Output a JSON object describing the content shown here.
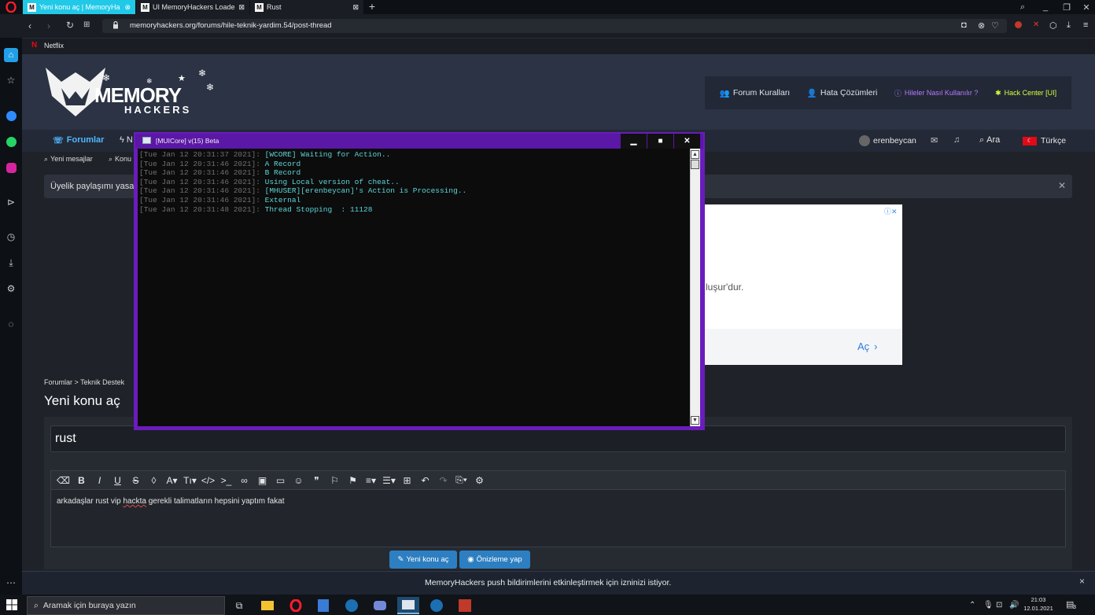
{
  "browser": {
    "tabs": [
      {
        "label": "Yeni konu aç | MemoryHa",
        "favicon": "M"
      },
      {
        "label": "UI MemoryHackers Loader",
        "favicon": "M"
      },
      {
        "label": "Rust",
        "favicon": "M"
      }
    ],
    "url": "memoryhackers.org/forums/hile-teknik-yardim.54/post-thread",
    "bookmark": "Netflix"
  },
  "site": {
    "logo_top": "MEMORY",
    "logo_bottom": "HACKERS",
    "topnav": [
      "Forum Kuralları",
      "Hata Çözümleri",
      "Hileler Nasıl Kullanılır ?",
      "Hack Center [UI]"
    ],
    "nav": {
      "forums": "Forumlar",
      "partial": "N",
      "user": "erenbeycan",
      "search": "Ara",
      "language": "Türkçe"
    },
    "subnav": {
      "new_messages": "Yeni mesajlar",
      "partial": "Konu"
    },
    "notice": "Üyelik paylaşımı yasa",
    "ad_text": "luşur'dur.",
    "ad_button": "Aç",
    "breadcrumb": {
      "root": "Forumlar",
      "sep": ">",
      "child": "Teknik Destek"
    },
    "page_title": "Yeni konu aç",
    "thread_title": "rust",
    "editor_text_1": "arkadaşlar rust vip ",
    "editor_text_err": "hackta",
    "editor_text_2": " gerekli talimatların hepsini yaptım fakat",
    "btn_post": "Yeni konu aç",
    "btn_preview": "Önizleme yap",
    "push_text": "MemoryHackers push bildirimlerini etkinleştirmek için izninizi istiyor.",
    "push_close": "×"
  },
  "console": {
    "title": "[MUICore] v(15) Beta",
    "lines": [
      {
        "ts": "[Tue Jan 12 20:31:37 2021]: ",
        "msg": "[WCORE] Waiting for Action.."
      },
      {
        "ts": "[Tue Jan 12 20:31:46 2021]: ",
        "msg": "A Record"
      },
      {
        "ts": "[Tue Jan 12 20:31:46 2021]: ",
        "msg": "B Record"
      },
      {
        "ts": "[Tue Jan 12 20:31:46 2021]: ",
        "msg": "Using Local version of cheat.."
      },
      {
        "ts": "[Tue Jan 12 20:31:46 2021]: ",
        "msg": "[MHUSER][erenbeycan]'s Action is Processing.."
      },
      {
        "ts": "[Tue Jan 12 20:31:46 2021]: ",
        "msg": "External"
      },
      {
        "ts": "[Tue Jan 12 20:31:48 2021]: ",
        "msg": "Thread Stopping  : 11128"
      }
    ]
  },
  "taskbar": {
    "search_placeholder": "Aramak için buraya yazın",
    "time": "21:03",
    "date": "12.01.2021",
    "notif_count": "3"
  },
  "colors": {
    "accent": "#21c9e8",
    "console_frame": "#6a1cbc",
    "console_text": "#5ed4d6",
    "button": "#2d7fc1"
  }
}
